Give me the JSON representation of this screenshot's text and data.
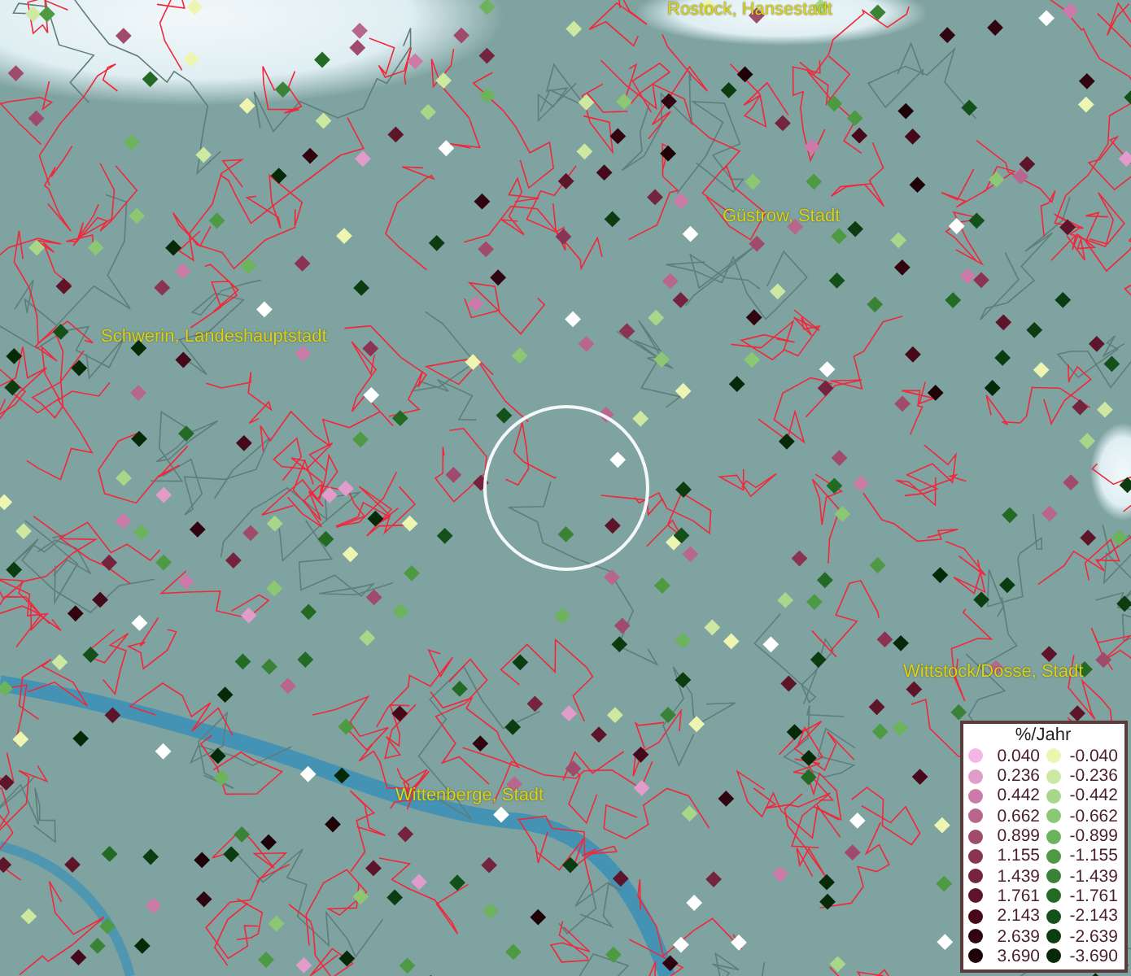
{
  "map": {
    "cities": [
      {
        "name": "Rostock, Hansestadt"
      },
      {
        "name": "Güstrow, Stadt"
      },
      {
        "name": "Schwerin, Landeshauptstadt"
      },
      {
        "name": "Wittstock/Dosse, Stadt"
      },
      {
        "name": "Wittenberge, Stadt"
      }
    ]
  },
  "legend": {
    "title": "%/Jahr",
    "positive": [
      {
        "value": "0.040",
        "color": "#f4b6e6"
      },
      {
        "value": "0.236",
        "color": "#e29ccb"
      },
      {
        "value": "0.442",
        "color": "#cc7ba8"
      },
      {
        "value": "0.662",
        "color": "#b8668e"
      },
      {
        "value": "0.899",
        "color": "#a04b6c"
      },
      {
        "value": "1.155",
        "color": "#8a3352"
      },
      {
        "value": "1.439",
        "color": "#75243f"
      },
      {
        "value": "1.761",
        "color": "#5e1429"
      },
      {
        "value": "2.143",
        "color": "#46091a"
      },
      {
        "value": "2.639",
        "color": "#300510"
      },
      {
        "value": "3.690",
        "color": "#1e0208"
      }
    ],
    "negative": [
      {
        "value": "-0.040",
        "color": "#eef5b0"
      },
      {
        "value": "-0.236",
        "color": "#cde8a0"
      },
      {
        "value": "-0.442",
        "color": "#a9d689"
      },
      {
        "value": "-0.662",
        "color": "#8cc873"
      },
      {
        "value": "-0.899",
        "color": "#6cb45c"
      },
      {
        "value": "-1.155",
        "color": "#4d9a43"
      },
      {
        "value": "-1.439",
        "color": "#3a8336"
      },
      {
        "value": "-1.761",
        "color": "#236b25"
      },
      {
        "value": "-2.143",
        "color": "#14511a"
      },
      {
        "value": "-2.639",
        "color": "#0b3d10"
      },
      {
        "value": "-3.690",
        "color": "#062a08"
      }
    ]
  }
}
